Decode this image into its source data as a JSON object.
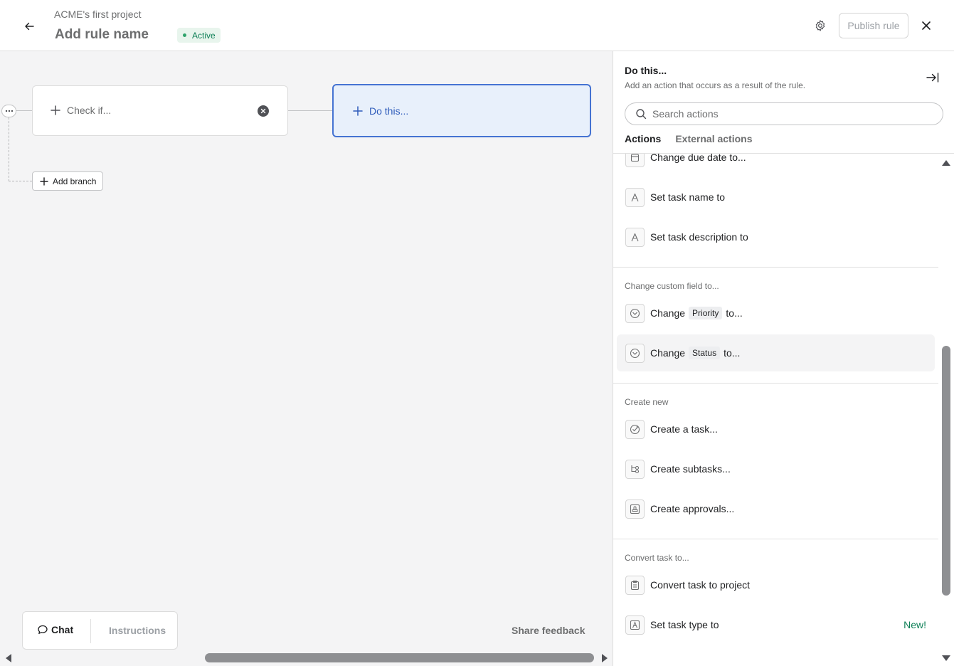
{
  "header": {
    "project_name": "ACME's first project",
    "rule_name": "Add rule name",
    "status": "Active",
    "publish_label": "Publish rule"
  },
  "canvas": {
    "check_label": "Check if...",
    "do_label": "Do this...",
    "add_branch_label": "Add branch",
    "chat_label": "Chat",
    "instructions_label": "Instructions",
    "share_feedback_label": "Share feedback"
  },
  "panel": {
    "title": "Do this...",
    "subtitle": "Add an action that occurs as a result of the rule.",
    "search_placeholder": "Search actions",
    "tabs": [
      {
        "label": "Actions",
        "active": true
      },
      {
        "label": "External actions",
        "active": false
      }
    ],
    "items_top": [
      {
        "label": "Change due date to...",
        "icon": "calendar-icon"
      },
      {
        "label": "Set task name to",
        "icon": "text-icon"
      },
      {
        "label": "Set task description to",
        "icon": "text-icon"
      }
    ],
    "custom_field_section": {
      "header": "Change custom field to...",
      "items": [
        {
          "prefix": "Change",
          "field": "Priority",
          "suffix": "to..."
        },
        {
          "prefix": "Change",
          "field": "Status",
          "suffix": "to..."
        }
      ]
    },
    "create_section": {
      "header": "Create new",
      "items": [
        {
          "label": "Create a task...",
          "icon": "task-check-icon"
        },
        {
          "label": "Create subtasks...",
          "icon": "subtasks-icon"
        },
        {
          "label": "Create approvals...",
          "icon": "approval-stamp-icon"
        }
      ]
    },
    "convert_section": {
      "header": "Convert task to...",
      "items": [
        {
          "label": "Convert task to project",
          "icon": "project-clipboard-icon"
        },
        {
          "label": "Set task type to",
          "icon": "task-type-icon",
          "badge": "New!"
        }
      ]
    }
  },
  "colors": {
    "accent": "#4573d2",
    "active_green": "#0d7f56",
    "canvas_bg": "#f4f4f5"
  }
}
